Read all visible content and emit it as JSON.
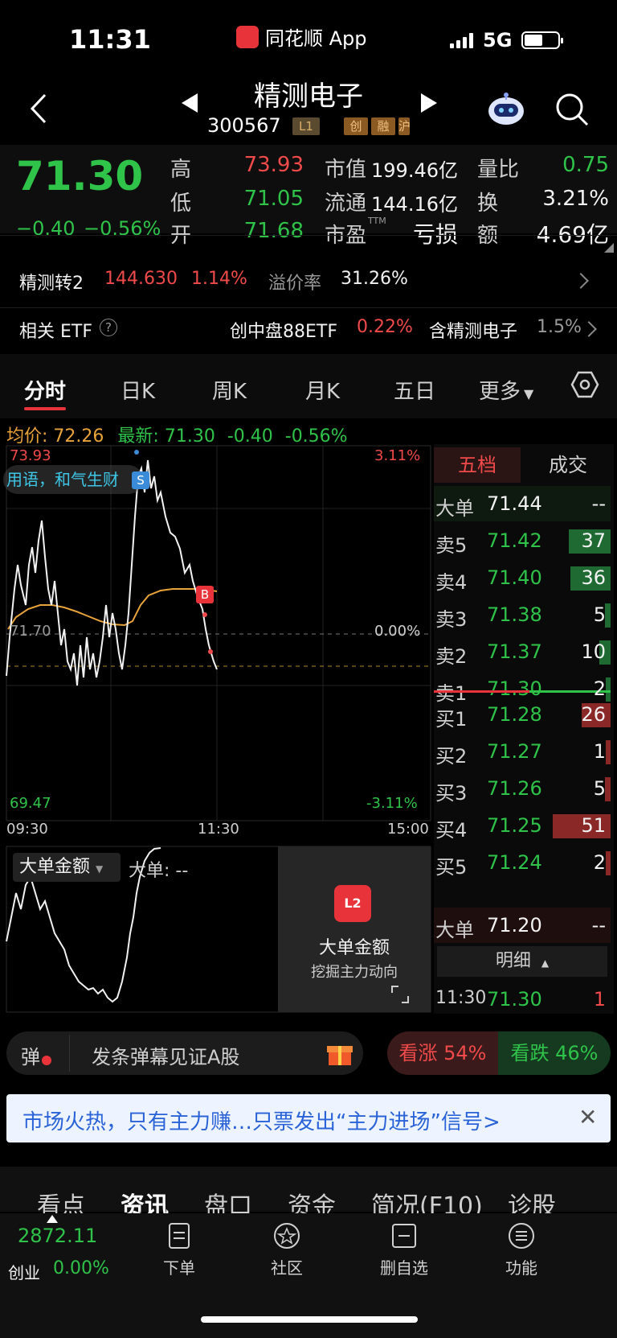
{
  "status_bar": {
    "time": "11:31",
    "app_name": "同花顺 App",
    "network": "5G"
  },
  "header": {
    "stock_name": "精测电子",
    "stock_code": "300567",
    "tags": [
      "L1",
      "创",
      "融",
      "沪"
    ]
  },
  "quote": {
    "last_price": "71.30",
    "change_abs": "−0.40",
    "change_pct": "−0.56%",
    "high_label": "高",
    "high": "73.93",
    "low_label": "低",
    "low": "71.05",
    "open_label": "开",
    "open": "71.68",
    "mcap_label": "市值",
    "mcap": "199.46亿",
    "float_label": "流通",
    "float": "144.16亿",
    "pe_label": "市盈",
    "pe_sup": "TTM",
    "pe": "亏损",
    "vol_ratio_label": "量比",
    "vol_ratio": "0.75",
    "turnover_label": "换",
    "turnover": "3.21%",
    "amount_label": "额",
    "amount": "4.69亿"
  },
  "bond": {
    "name": "精测转2",
    "price": "144.630",
    "pct": "1.14%",
    "premium_label": "溢价率",
    "premium": "31.26%"
  },
  "etf": {
    "label": "相关 ETF",
    "help": "?",
    "name": "创中盘88ETF",
    "pct": "0.22%",
    "weight_label": "含精测电子",
    "weight": "1.5%"
  },
  "period_tabs": [
    "分时",
    "日K",
    "周K",
    "月K",
    "五日",
    "更多"
  ],
  "avg_info": {
    "avg_label": "均价:",
    "avg": "72.26",
    "latest_label": "最新:",
    "latest": "71.30",
    "chg": "-0.40",
    "pct": "-0.56%"
  },
  "chart": {
    "high_label": "73.93",
    "high_pct": "3.11%",
    "mid_label": "71.70",
    "mid_pct": "0.00%",
    "low_label": "69.47",
    "low_pct": "-3.11%",
    "ticker_text": "用语，和气生财",
    "sell_marker": "S",
    "buy_marker": "B",
    "time_start": "09:30",
    "time_mid": "11:30",
    "time_end": "15:00"
  },
  "volume_panel": {
    "label": "大单金额",
    "value_label": "大单: --",
    "promo_title": "大单金额",
    "promo_sub": "挖掘主力动向",
    "promo_icon": "L2"
  },
  "orderbook": {
    "tab_active": "五档",
    "tab_other": "成交",
    "big_sell": {
      "label": "大单",
      "price": "71.44",
      "qty": "--"
    },
    "asks": [
      {
        "label": "卖5",
        "price": "71.42",
        "qty": "37",
        "fill": 0.72
      },
      {
        "label": "卖4",
        "price": "71.40",
        "qty": "36",
        "fill": 0.7
      },
      {
        "label": "卖3",
        "price": "71.38",
        "qty": "5",
        "fill": 0.1
      },
      {
        "label": "卖2",
        "price": "71.37",
        "qty": "10",
        "fill": 0.2
      },
      {
        "label": "卖1",
        "price": "71.30",
        "qty": "2",
        "fill": 0.04
      }
    ],
    "bids": [
      {
        "label": "买1",
        "price": "71.28",
        "qty": "26",
        "fill": 0.5
      },
      {
        "label": "买2",
        "price": "71.27",
        "qty": "1",
        "fill": 0.02
      },
      {
        "label": "买3",
        "price": "71.26",
        "qty": "5",
        "fill": 0.1
      },
      {
        "label": "买4",
        "price": "71.25",
        "qty": "51",
        "fill": 1.0
      },
      {
        "label": "买5",
        "price": "71.24",
        "qty": "2",
        "fill": 0.04
      }
    ],
    "big_buy": {
      "label": "大单",
      "price": "71.20",
      "qty": "--"
    },
    "detail_label": "明细",
    "last_trade": {
      "time": "11:30",
      "price": "71.30",
      "qty": "1"
    }
  },
  "danmu": {
    "icon": "弹",
    "placeholder": "发条弹幕见证A股"
  },
  "sentiment": {
    "bull": "看涨 54%",
    "bear": "看跌 46%"
  },
  "promo": {
    "text": "市场火热，只有主力赚…只票发出“主力进场”信号>",
    "close": "✕"
  },
  "section_tabs": [
    "看点",
    "资讯",
    "盘口",
    "资金",
    "简况(F10)",
    "诊股"
  ],
  "bottom_nav": {
    "index_value": "2872.11",
    "index_name": "创业",
    "index_pct": "0.00%",
    "items": [
      "下单",
      "社区",
      "删自选",
      "功能"
    ]
  }
}
